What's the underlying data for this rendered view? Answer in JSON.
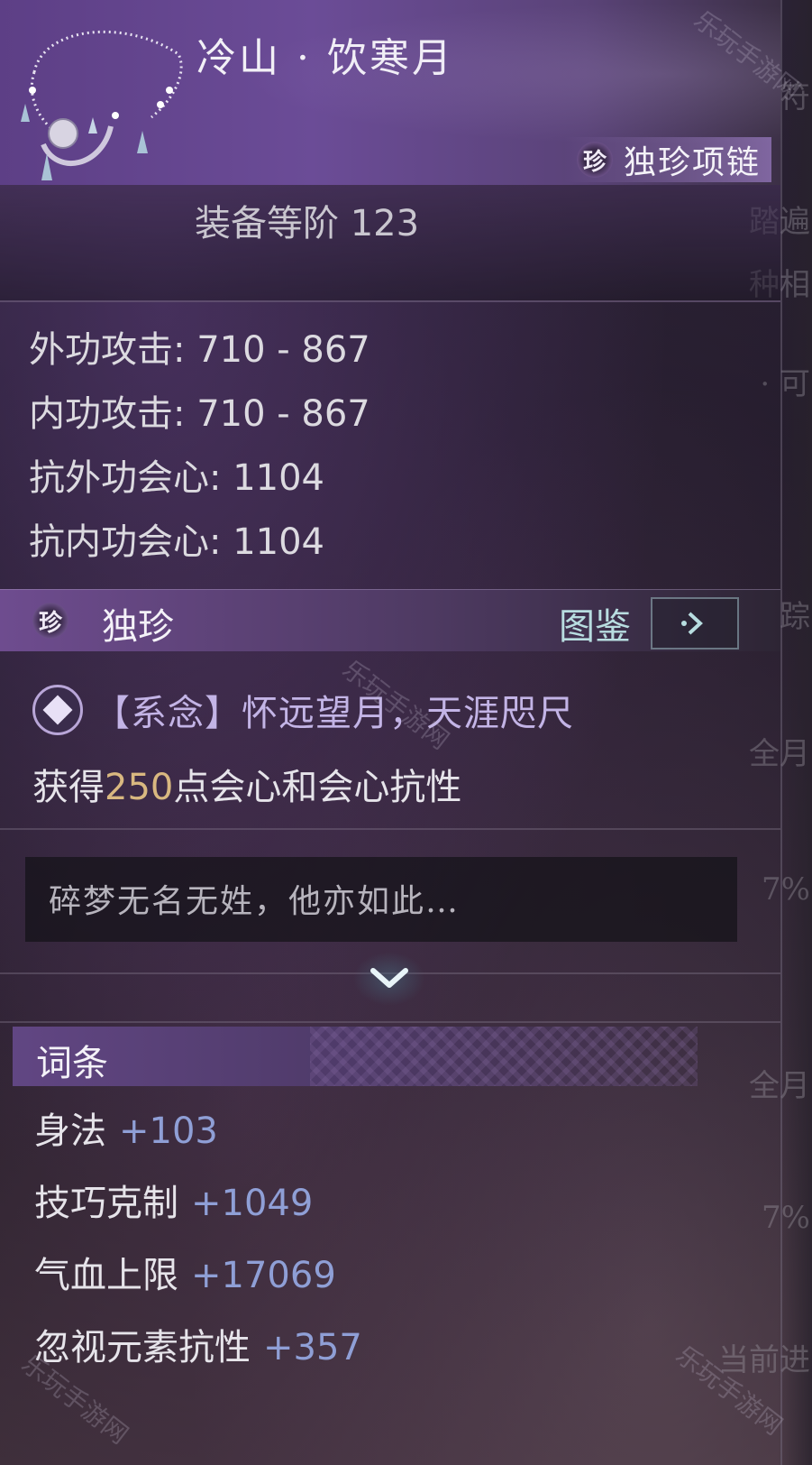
{
  "item": {
    "name": "冷山 · 饮寒月",
    "rarity_icon": "珍",
    "type": "独珍项链",
    "level_text": "装备等阶 123"
  },
  "stats": [
    "外功攻击: 710 - 867",
    "内功攻击: 710 - 867",
    "抗外功会心: 1104",
    "抗内功会心: 1104"
  ],
  "unique": {
    "icon": "珍",
    "label": "独珍",
    "tujian_label": "图鉴",
    "xinian_text": "【系念】怀远望月，天涯咫尺",
    "effect_prefix": "获得",
    "effect_value": "250",
    "effect_suffix": "点会心和会心抗性",
    "flavor": "碎梦无名无姓，他亦如此…"
  },
  "cito": {
    "label": "词条",
    "items": [
      {
        "name": "身法",
        "value": "+103"
      },
      {
        "name": "技巧克制",
        "value": "+1049"
      },
      {
        "name": "气血上限",
        "value": "+17069"
      },
      {
        "name": "忽视元素抗性",
        "value": "+357"
      }
    ]
  },
  "side_panel": [
    "渔符",
    "踏遍",
    "种相",
    "· 可",
    "追踪",
    "全月",
    "7%",
    "全月",
    "7%",
    "当前进"
  ],
  "watermark": "乐玩手游网",
  "colors": {
    "header_purple": "#6b4c97",
    "highlight_gold": "#d9b880",
    "attr_value_blue": "#8f9fd6",
    "xinian_purple": "#c3b4e6"
  }
}
